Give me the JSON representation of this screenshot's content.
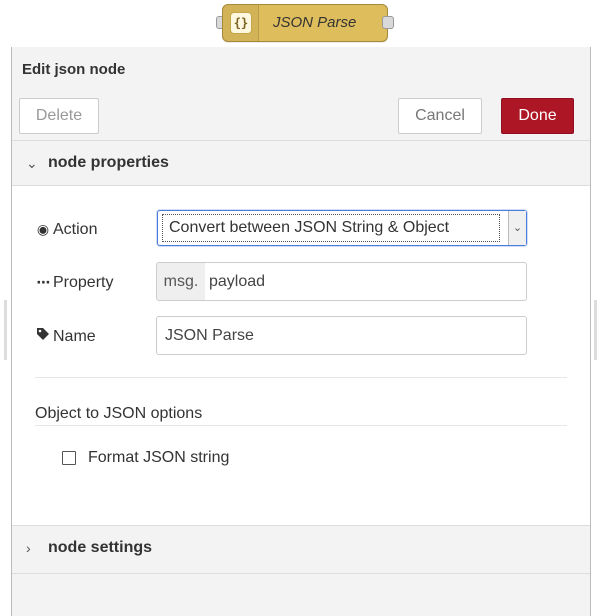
{
  "node": {
    "label": "JSON Parse",
    "icon_glyph": "{}",
    "icon": "json-braces-icon",
    "color": "#debd5c"
  },
  "tray": {
    "title": "Edit json node",
    "buttons": {
      "delete": "Delete",
      "cancel": "Cancel",
      "done": "Done"
    },
    "accent_color": "#ad1625"
  },
  "sections": {
    "properties": {
      "label": "node properties",
      "expanded": true
    },
    "settings": {
      "label": "node settings",
      "expanded": false
    }
  },
  "form": {
    "action": {
      "label": "Action",
      "icon": "dot-circle-icon",
      "selected": "Convert between JSON String & Object"
    },
    "property": {
      "label": "Property",
      "icon": "ellipsis-icon",
      "prefix": "msg.",
      "value": "payload"
    },
    "name": {
      "label": "Name",
      "icon": "tag-icon",
      "value": "JSON Parse"
    },
    "options": {
      "heading": "Object to JSON options",
      "format_json": {
        "label": "Format JSON string",
        "checked": false
      }
    }
  }
}
